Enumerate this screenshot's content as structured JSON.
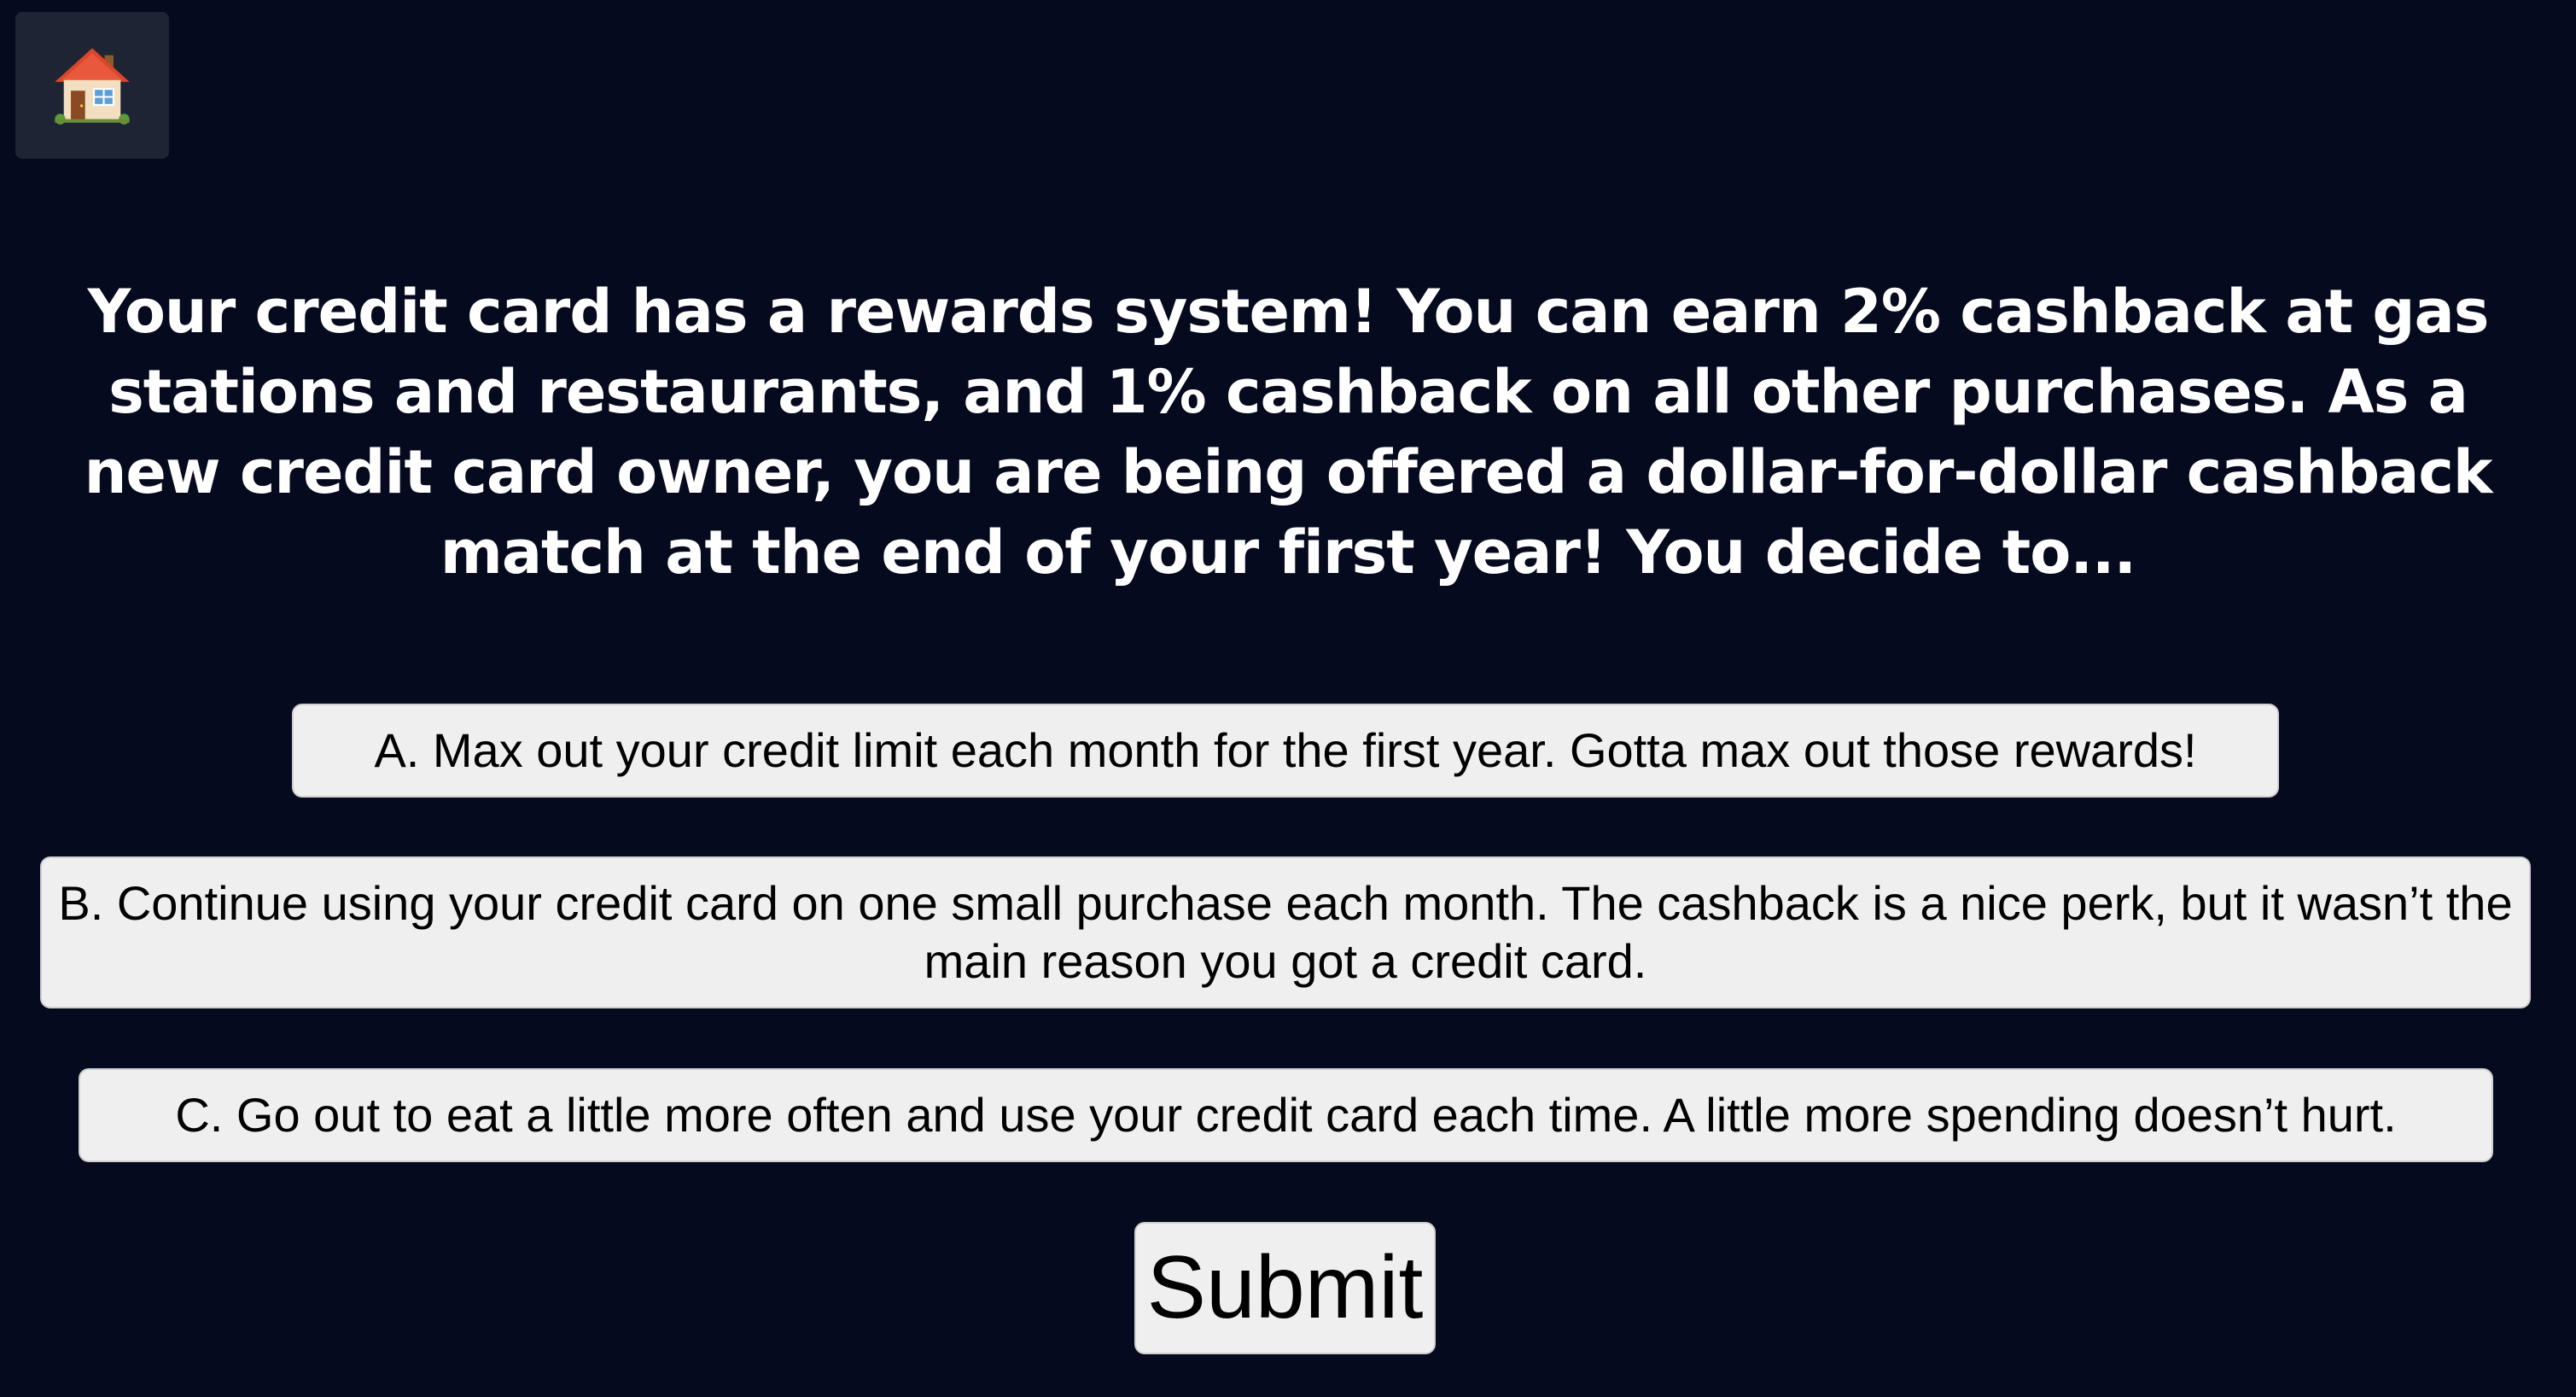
{
  "home": {
    "icon": "house-icon"
  },
  "question": {
    "text": "Your credit card has a rewards system! You can earn 2% cashback at gas stations and restaurants, and 1% cashback on all other purchases. As a new credit card owner, you are being offered a dollar-for-dollar cashback match at the end of your first year! You decide to..."
  },
  "choices": [
    {
      "label": "A. Max out your credit limit each month for the first year. Gotta max out those rewards!"
    },
    {
      "label": "B. Continue using your credit card on one small purchase each month. The cashback is a nice perk, but it wasn’t the main reason you got a credit card."
    },
    {
      "label": "C. Go out to eat a little more often and use your credit card each time. A little more spending doesn’t hurt."
    }
  ],
  "submit": {
    "label": "Submit"
  },
  "colors": {
    "background": "#050a1e",
    "button": "#efefef",
    "home_button": "#1e2433",
    "question_text": "#ffffff"
  }
}
